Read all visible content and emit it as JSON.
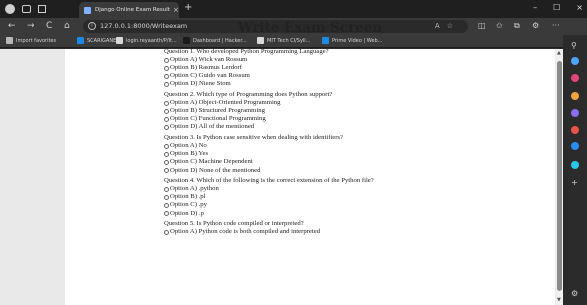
{
  "browser": {
    "tab_title": "Django Online Exam Result",
    "tab_close": "×",
    "new_tab": "+",
    "url": "127.0.0.1:8000/Writeexam",
    "info_icon": "i",
    "address_icons": "A☆",
    "nav": {
      "back": "←",
      "forward": "→",
      "reload": "C",
      "home": "⌂"
    },
    "window_controls": {
      "minimize": "–",
      "maximize": "☐",
      "close": "×"
    },
    "toolbar_right": {
      "split": "◫",
      "favorites": "✩",
      "collections": "⧉",
      "extensions": "⚙",
      "more": "···"
    },
    "bookmarks": [
      {
        "label": "Import favorites",
        "color": "#b8b8b8"
      },
      {
        "label": "SCARIGANE",
        "color": "#1e88e5"
      },
      {
        "label": "login.reyaanth/P/lt...",
        "color": "#d9d9d9"
      },
      {
        "label": "Dashboard | Hacker...",
        "color": "#1b1b1b"
      },
      {
        "label": "MIT Tech Cl/Syll...",
        "color": "#d9d9d9"
      },
      {
        "label": "Prime Video | Web...",
        "color": "#1e88e5"
      }
    ]
  },
  "exam": {
    "title": "Write Exam Screen",
    "questions": [
      {
        "text": "Question 1. Who developed Python Programming Language?",
        "options": [
          "Option A) Wick van Rossum",
          "Option B) Rasmus Lerdorf",
          "Option C) Guido van Rossum",
          "Option D) Niene Stom"
        ]
      },
      {
        "text": "Question 2. Which type of Programming does Python support?",
        "options": [
          "Option A) Object-Oriented Programming",
          "Option B) Structured Programming",
          "Option C) Functional Programming",
          "Option D) All of the mentioned"
        ]
      },
      {
        "text": "Question 3. Is Python case sensitive when dealing with identifiers?",
        "options": [
          "Option A) No",
          "Option B) Yes",
          "Option C) Machine Dependent",
          "Option D) None of the mentioned"
        ]
      },
      {
        "text": "Question 4. Which of the following is the correct extension of the Python file?",
        "options": [
          "Option A) .python",
          "Option B) .pl",
          "Option C) .py",
          "Option D) .p"
        ]
      },
      {
        "text": "Question 5. Is Python code compiled or interpreted?",
        "options": [
          "Option A) Python code is both compiled and interpreted"
        ]
      }
    ]
  },
  "scrollbar": {
    "up": "▲",
    "down": "▼"
  },
  "sidebar": {
    "items": [
      {
        "name": "search-icon",
        "glyph": "⚲",
        "color": "#d0d0d0"
      },
      {
        "name": "copilot-icon",
        "color": "#4da3ff"
      },
      {
        "name": "shopping-icon",
        "color": "#e0457b"
      },
      {
        "name": "tools-icon",
        "color": "#f2a33a"
      },
      {
        "name": "games-icon",
        "color": "#8e6cf0"
      },
      {
        "name": "office-icon",
        "color": "#e8534a"
      },
      {
        "name": "outlook-icon",
        "color": "#2b8df2"
      },
      {
        "name": "drop-icon",
        "color": "#29c7e8"
      }
    ],
    "add_glyph": "+",
    "settings_glyph": "⚙"
  }
}
